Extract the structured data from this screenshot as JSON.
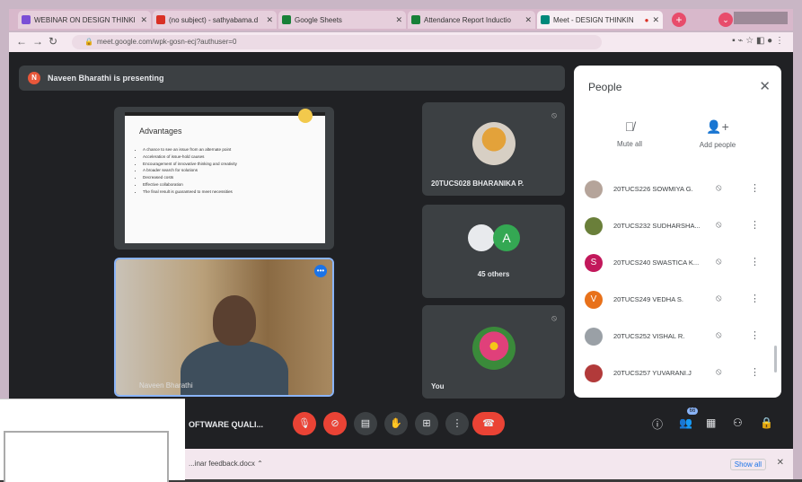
{
  "tabs": [
    {
      "label": "WEBINAR ON DESIGN THINKI",
      "color": "#7b4fd6"
    },
    {
      "label": "(no subject) - sathyabama.d",
      "color": "#d93025"
    },
    {
      "label": "Google Sheets",
      "color": "#188038"
    },
    {
      "label": "Attendance Report Inductio",
      "color": "#188038"
    },
    {
      "label": "Meet - DESIGN THINKIN",
      "color": "#00897b"
    }
  ],
  "address": {
    "url": "meet.google.com/wpk-gosn-ecj?authuser=0"
  },
  "presenting": {
    "avatar_letter": "N",
    "text": "Naveen Bharathi is presenting"
  },
  "slide": {
    "title": "Advantages",
    "bullets": [
      "A chance to see an issue from an alternate point",
      "Acceleration of issue-hold causes",
      "Encouragement of innovative thinking and creativity",
      "A broader search for solutions",
      "Decreased costs",
      "Effective collaboration",
      "The final result is guaranteed to meet necessities"
    ]
  },
  "camera": {
    "name": "Naveen Bharathi"
  },
  "participants_tiles": [
    {
      "name": "20TUCS028 BHARANIKA P."
    },
    {
      "name": "45 others",
      "avatar_letter": "A"
    },
    {
      "name": "You"
    }
  ],
  "people_panel": {
    "title": "People",
    "mute_all": "Mute all",
    "add_people": "Add people",
    "people": [
      {
        "name": "20TUCS226 SOWMIYA G.",
        "color": "#b5a49a",
        "letter": ""
      },
      {
        "name": "20TUCS232 SUDHARSHA...",
        "color": "#6a7f3a",
        "letter": ""
      },
      {
        "name": "20TUCS240 SWASTICA K...",
        "color": "#c2185b",
        "letter": "S"
      },
      {
        "name": "20TUCS249 VEDHA S.",
        "color": "#e8711a",
        "letter": "V"
      },
      {
        "name": "20TUCS252 VISHAL R.",
        "color": "#9aa0a6",
        "letter": ""
      },
      {
        "name": "20TUCS257 YUVARANI.J",
        "color": "#b23a3a",
        "letter": ""
      }
    ]
  },
  "meeting": {
    "title": "OFTWARE QUALI...",
    "people_count": "66"
  },
  "downloads": {
    "item": "...inar feedback.docx",
    "show_all": "Show all"
  }
}
